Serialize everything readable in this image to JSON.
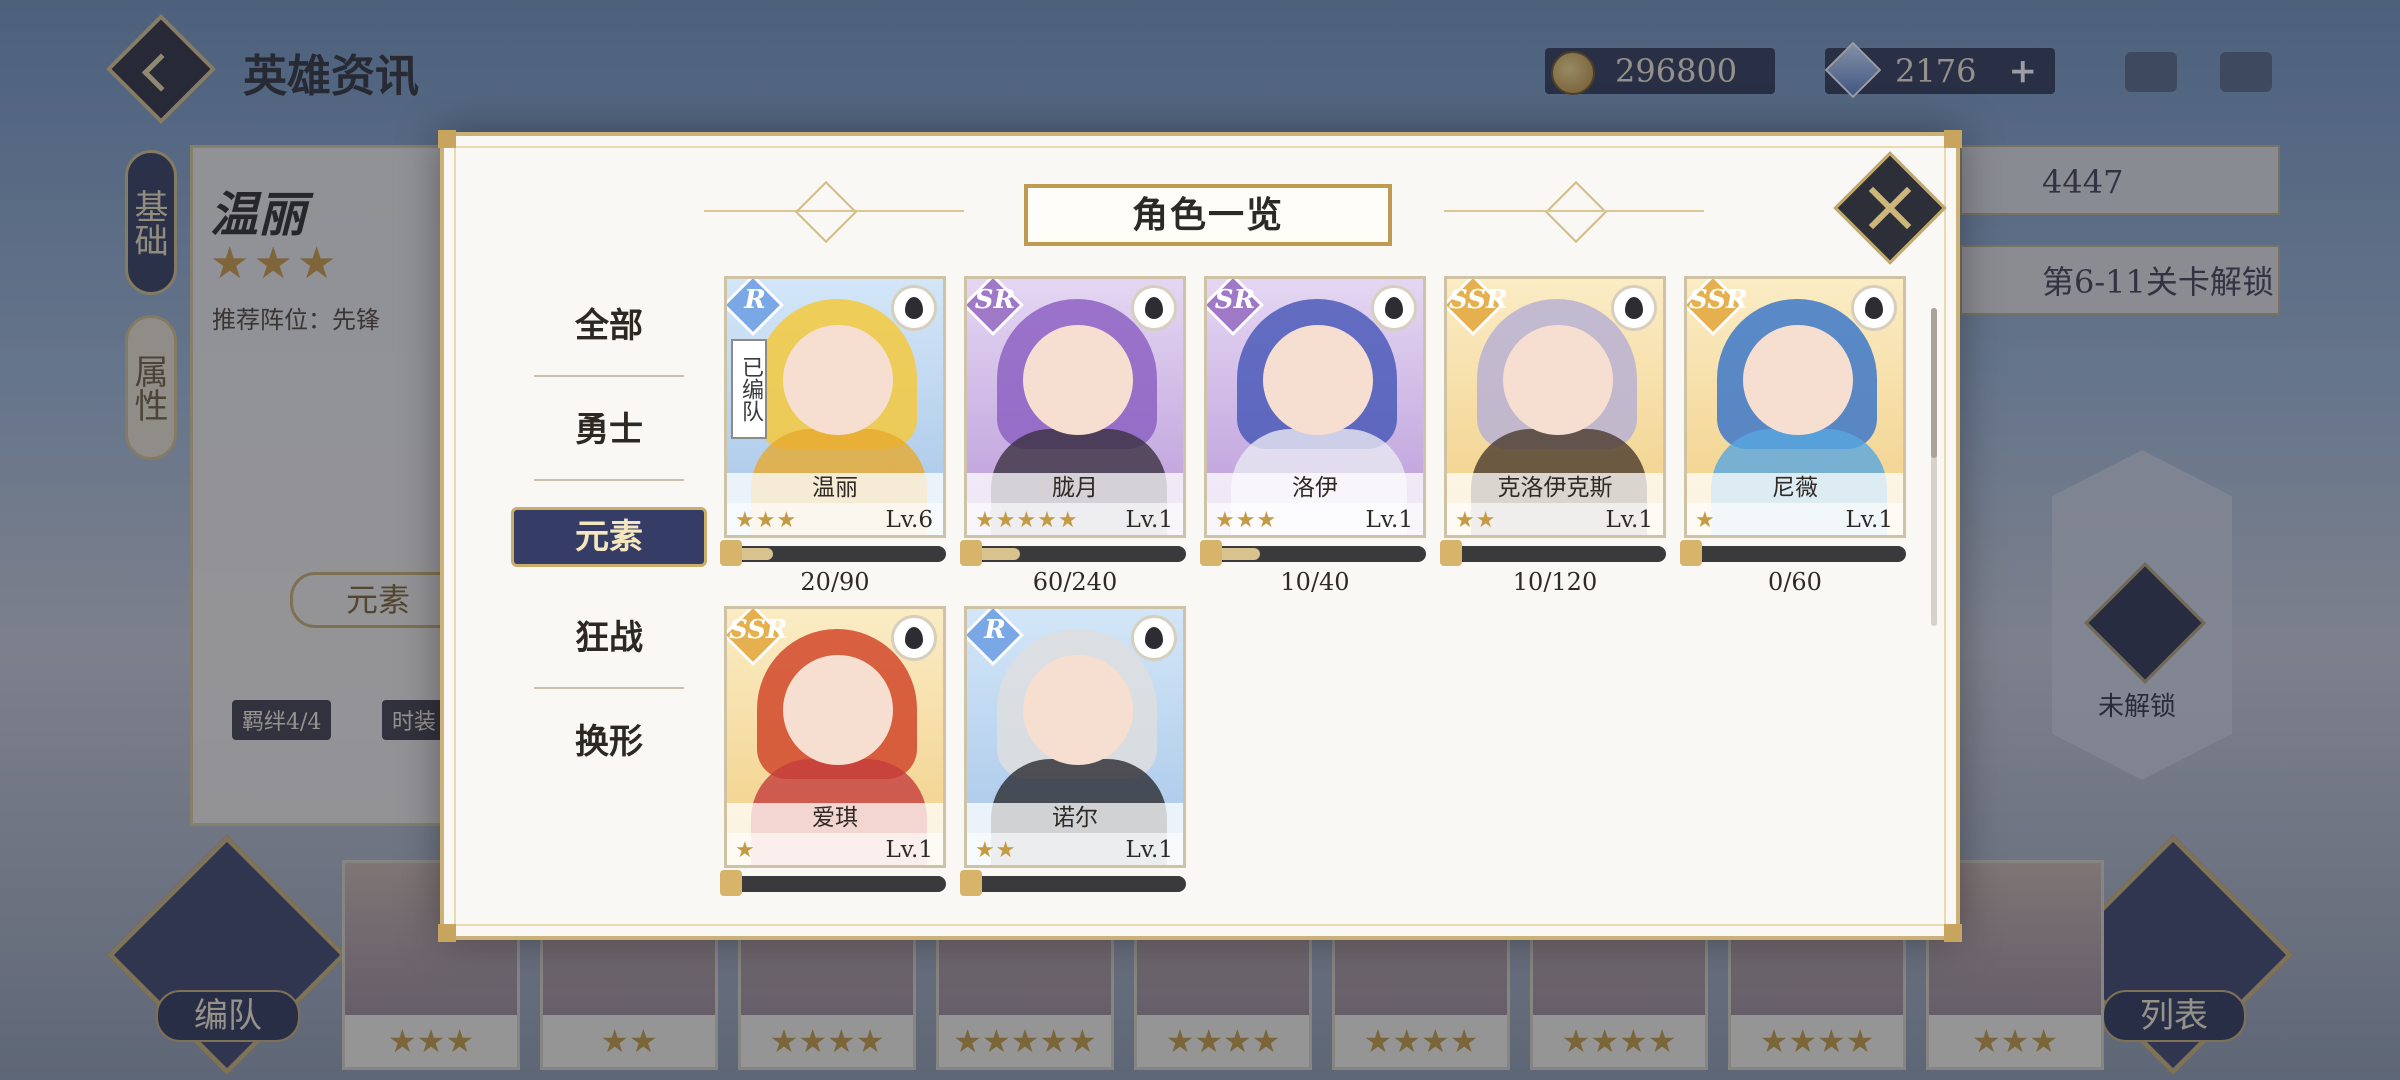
{
  "header": {
    "title": "英雄资讯",
    "gold": "296800",
    "gems": "2176",
    "plus_label": "+"
  },
  "hero_panel": {
    "tabs": [
      "基础",
      "属性"
    ],
    "name": "温丽",
    "stars": "★★★",
    "recommended": "推荐阵位：先锋",
    "element_tag": "元素",
    "badges": [
      "羁绊4/4",
      "时装"
    ]
  },
  "right_widgets": {
    "power": "4447",
    "unlock_hint": "第6-11关卡解锁",
    "locked_label": "未解锁"
  },
  "bottom": {
    "team_button": "编队",
    "list_button": "列表",
    "in_team_label": "已编队",
    "thumb_stars": [
      "★★★",
      "★★",
      "★★★★",
      "★★★★★",
      "★★★★",
      "★★★★",
      "★★★★",
      "★★★★",
      "★★★"
    ]
  },
  "modal": {
    "title": "角色一览",
    "filters": [
      {
        "label": "全部",
        "active": false
      },
      {
        "label": "勇士",
        "active": false
      },
      {
        "label": "元素",
        "active": true
      },
      {
        "label": "狂战",
        "active": false
      },
      {
        "label": "换形",
        "active": false
      }
    ],
    "characters": [
      {
        "name": "温丽",
        "rarity": "R",
        "stars": "★★★",
        "level": "Lv.6",
        "progress": "20/90",
        "fraction": 0.22,
        "in_team": "已编队",
        "hair": "#f4c93d",
        "body": "#e7a92e"
      },
      {
        "name": "胧月",
        "rarity": "SR",
        "stars": "★★★★★",
        "level": "Lv.1",
        "progress": "60/240",
        "fraction": 0.25,
        "in_team": "",
        "hair": "#8d62c2",
        "body": "#3a3140"
      },
      {
        "name": "洛伊",
        "rarity": "SR",
        "stars": "★★★",
        "level": "Lv.1",
        "progress": "10/40",
        "fraction": 0.25,
        "in_team": "",
        "hair": "#4b5bb8",
        "body": "#e9e8f3"
      },
      {
        "name": "克洛伊克斯",
        "rarity": "SSR",
        "stars": "★★",
        "level": "Lv.1",
        "progress": "10/120",
        "fraction": 0.08,
        "in_team": "",
        "hair": "#b9b2d4",
        "body": "#4a3a2c"
      },
      {
        "name": "尼薇",
        "rarity": "SSR",
        "stars": "★",
        "level": "Lv.1",
        "progress": "0/60",
        "fraction": 0.0,
        "in_team": "",
        "hair": "#3d78c9",
        "body": "#57a6df"
      },
      {
        "name": "爱琪",
        "rarity": "SSR",
        "stars": "★",
        "level": "Lv.1",
        "progress": "",
        "fraction": 0.0,
        "in_team": "",
        "hair": "#d1482a",
        "body": "#c43c3c"
      },
      {
        "name": "诺尔",
        "rarity": "R",
        "stars": "★★",
        "level": "Lv.1",
        "progress": "",
        "fraction": 0.0,
        "in_team": "",
        "hair": "#dedede",
        "body": "#2b2b31"
      }
    ]
  }
}
